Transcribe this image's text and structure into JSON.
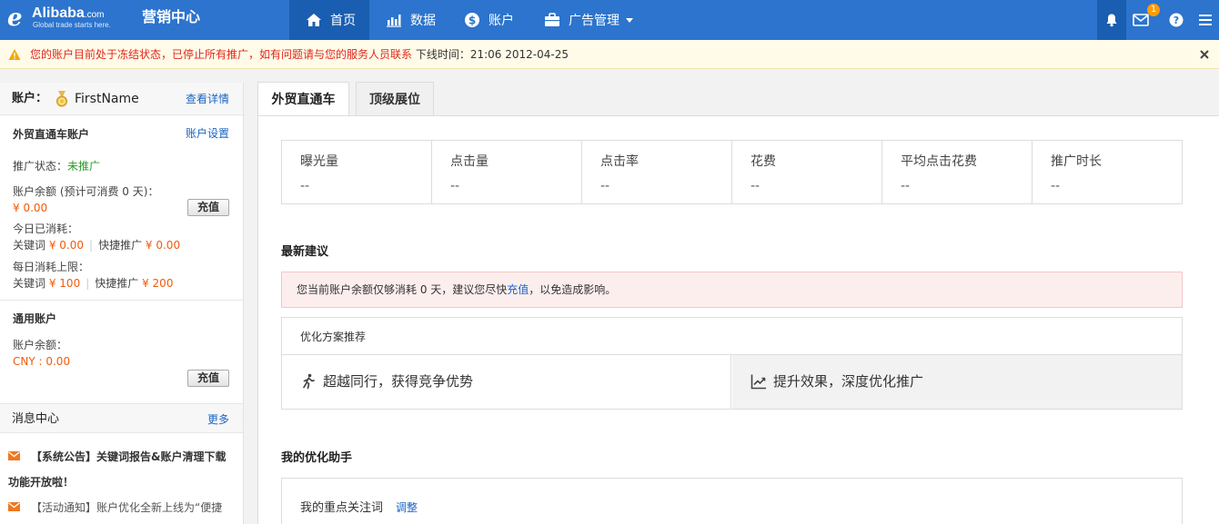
{
  "header": {
    "logo": {
      "brand_text": "Alibaba",
      "brand_suffix": ".com",
      "slogan": "Global trade starts here."
    },
    "app_title": "营销中心",
    "nav": [
      {
        "label": "首页",
        "icon": "home-icon",
        "active": true
      },
      {
        "label": "数据",
        "icon": "bar-chart-icon",
        "active": false
      },
      {
        "label": "账户",
        "icon": "dollar-icon",
        "active": false
      },
      {
        "label": "广告管理",
        "icon": "briefcase-icon",
        "active": false,
        "dropdown": true
      }
    ],
    "messages_badge": "1",
    "colors": {
      "bar": "#2c74cd",
      "active": "#1a5eb1",
      "badge": "#ff9c00"
    }
  },
  "notice": {
    "message": "您的账户目前处于冻结状态，已停止所有推广，如有问题请与您的服务人员联系",
    "offline_label": "下线时间：",
    "offline_time": "21:06 2012-04-25"
  },
  "sidebar": {
    "account_label": "账户：",
    "account_name": "FirstName",
    "view_details": "查看详情",
    "p4p": {
      "title": "外贸直通车账户",
      "settings_link": "账户设置",
      "status_label": "推广状态：",
      "status_value": "未推广",
      "balance_label": "账户余额 (预计可消费 0 天)：",
      "balance_value": "¥ 0.00",
      "recharge": "充值",
      "today_label": "今日已消耗：",
      "keyword_label": "关键词",
      "keyword_today": "¥ 0.00",
      "quick_label": "快捷推广",
      "quick_today": "¥ 0.00",
      "daily_limit_label": "每日消耗上限：",
      "keyword_limit": "¥ 100",
      "quick_limit": "¥ 200"
    },
    "general": {
      "title": "通用账户",
      "balance_label": "账户余额：",
      "balance_value": "CNY : 0.00",
      "recharge": "充值"
    },
    "messages": {
      "title": "消息中心",
      "more": "更多",
      "items": [
        {
          "line1": "【系统公告】关键词报告&账户清理下载",
          "line2": "功能开放啦！"
        },
        {
          "line1": "【活动通知】账户优化全新上线为“便捷"
        }
      ]
    }
  },
  "main": {
    "tabs": [
      {
        "label": "外贸直通车",
        "active": true
      },
      {
        "label": "顶级展位",
        "active": false
      }
    ],
    "stats": [
      {
        "label": "曝光量",
        "value": "--"
      },
      {
        "label": "点击量",
        "value": "--"
      },
      {
        "label": "点击率",
        "value": "--"
      },
      {
        "label": "花费",
        "value": "--"
      },
      {
        "label": "平均点击花费",
        "value": "--"
      },
      {
        "label": "推广时长",
        "value": "--"
      }
    ],
    "suggestions": {
      "title": "最新建议",
      "text_before": "您当前账户余额仅够消耗 0 天，建议您尽快",
      "link": "充值",
      "text_after": "，以免造成影响。"
    },
    "optimization": {
      "title": "优化方案推荐",
      "options": [
        {
          "label": "超越同行，获得竞争优势",
          "icon": "runner-icon"
        },
        {
          "label": "提升效果，深度优化推广",
          "icon": "trend-up-icon"
        }
      ]
    },
    "assistant": {
      "title": "我的优化助手",
      "focus_label": "我的重点关注词",
      "adjust": "调整"
    }
  }
}
